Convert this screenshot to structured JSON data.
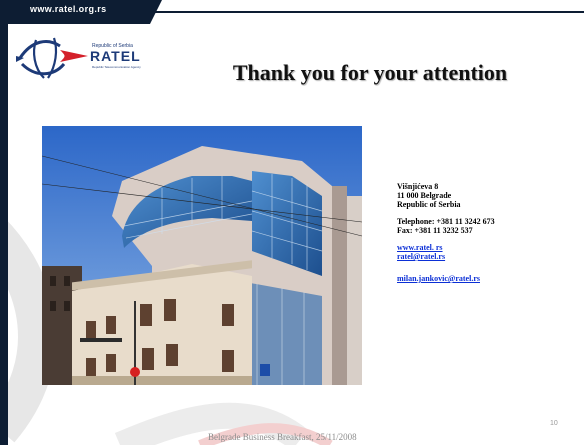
{
  "header": {
    "url": "www.ratel.org.rs"
  },
  "logo": {
    "line1": "Republic of Serbia",
    "name": "RATEL",
    "line3": "Republic Telecommunication Agency",
    "colors": {
      "blue": "#1d3a78",
      "red": "#d4202a"
    }
  },
  "slide": {
    "title": "Thank you for your attention"
  },
  "contact": {
    "address1": "Višnjićeva 8",
    "address2": "11 000 Belgrade",
    "address3": "Republic of Serbia",
    "telephone": "Telephone: +381 11 3242 673",
    "fax": "Fax: +381 11 3232 537",
    "website": "www.ratel. rs",
    "email": "ratel@ratel.rs",
    "person_email": "milan.jankovic@ratel.rs"
  },
  "footer": {
    "text": "Belgrade Business Breakfast, 25/11/2008",
    "page": "10"
  },
  "theme": {
    "dark_navy": "#0d1d33",
    "link_blue": "#0b2fd6"
  }
}
